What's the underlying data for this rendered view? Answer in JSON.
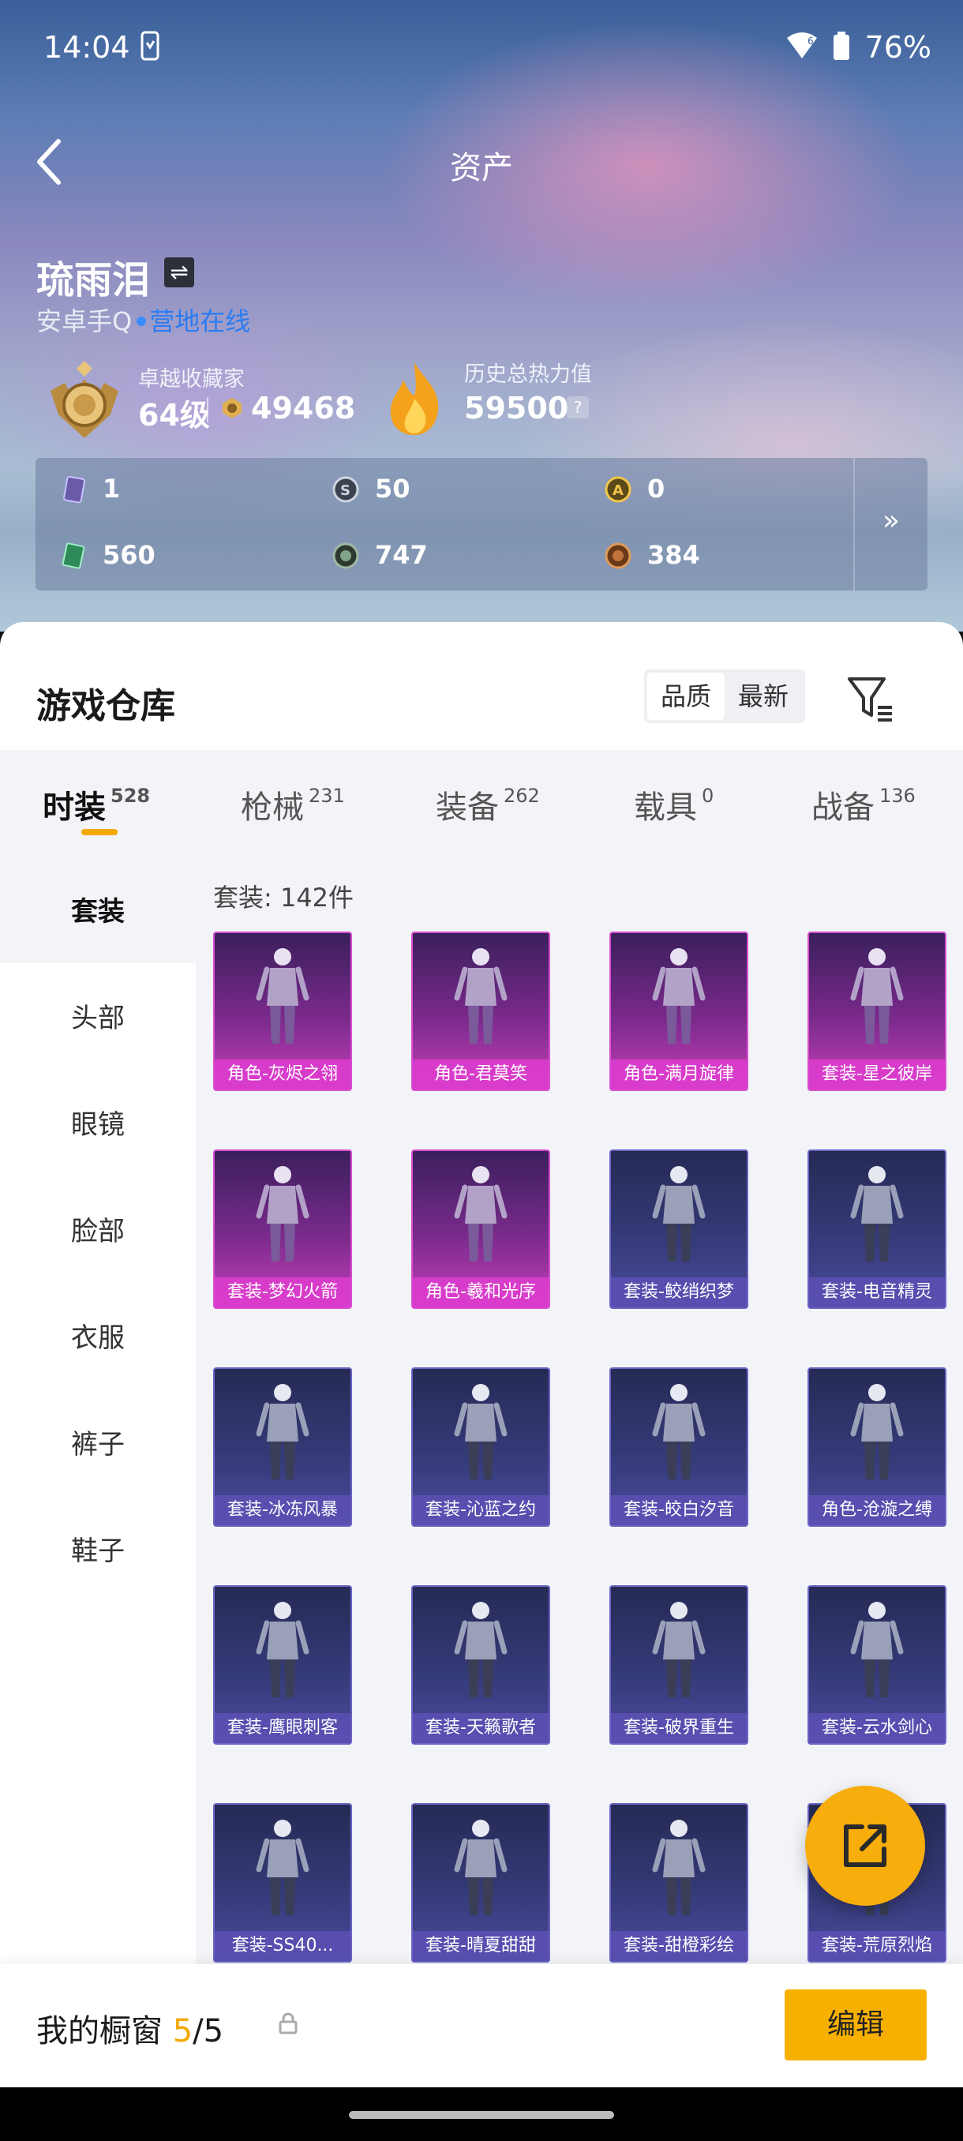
{
  "status": {
    "time": "14:04",
    "battery": "76%"
  },
  "header": {
    "title": "资产"
  },
  "profile": {
    "name": "琉雨泪",
    "switch_glyph": "⇌",
    "account_prefix": "安卓手Q",
    "account_status": "营地在线",
    "rank_title": "卓越收藏家",
    "rank_level": "64级",
    "rank_points": "49468",
    "heat_title": "历史总热力值",
    "heat_value": "59500",
    "heat_help": "?"
  },
  "currencies": [
    {
      "icon": "card-icon",
      "value": "1"
    },
    {
      "icon": "s-coin-icon",
      "value": "50"
    },
    {
      "icon": "a-coin-icon",
      "value": "0"
    },
    {
      "icon": "ticket-icon",
      "value": "560"
    },
    {
      "icon": "gem-icon",
      "value": "747"
    },
    {
      "icon": "bronze-coin-icon",
      "value": "384"
    }
  ],
  "currency_more": "»",
  "warehouse": {
    "title": "游戏仓库",
    "sort": [
      "品质",
      "最新"
    ],
    "tabs": [
      {
        "label": "时装",
        "count": "528"
      },
      {
        "label": "枪械",
        "count": "231"
      },
      {
        "label": "装备",
        "count": "262"
      },
      {
        "label": "载具",
        "count": "0"
      },
      {
        "label": "战备",
        "count": "136"
      }
    ],
    "side": [
      "套装",
      "头部",
      "眼镜",
      "脸部",
      "衣服",
      "裤子",
      "鞋子"
    ],
    "count_label": "套装: 142件",
    "items": [
      {
        "label": "角色-灰烬之翎",
        "rarity": "pink"
      },
      {
        "label": "角色-君莫笑",
        "rarity": "pink"
      },
      {
        "label": "角色-满月旋律",
        "rarity": "pink"
      },
      {
        "label": "套装-星之彼岸",
        "rarity": "pink"
      },
      {
        "label": "套装-梦幻火箭",
        "rarity": "pink"
      },
      {
        "label": "角色-羲和光序",
        "rarity": "pink"
      },
      {
        "label": "套装-鲛绡织梦",
        "rarity": "blue"
      },
      {
        "label": "套装-电音精灵",
        "rarity": "blue"
      },
      {
        "label": "套装-冰冻风暴",
        "rarity": "blue"
      },
      {
        "label": "套装-沁蓝之约",
        "rarity": "blue"
      },
      {
        "label": "套装-皎白汐音",
        "rarity": "blue"
      },
      {
        "label": "角色-沧漩之缚",
        "rarity": "blue"
      },
      {
        "label": "套装-鹰眼刺客",
        "rarity": "blue"
      },
      {
        "label": "套装-天籁歌者",
        "rarity": "blue"
      },
      {
        "label": "套装-破界重生",
        "rarity": "blue"
      },
      {
        "label": "套装-云水剑心",
        "rarity": "blue"
      },
      {
        "label": "套装-SS40...",
        "rarity": "blue"
      },
      {
        "label": "套装-晴夏甜甜",
        "rarity": "blue"
      },
      {
        "label": "套装-甜橙彩绘",
        "rarity": "blue"
      },
      {
        "label": "套装-荒原烈焰",
        "rarity": "blue"
      }
    ]
  },
  "showcase": {
    "label": "我的橱窗",
    "count": "5",
    "sep": "/",
    "total": "5",
    "edit": "编辑"
  }
}
